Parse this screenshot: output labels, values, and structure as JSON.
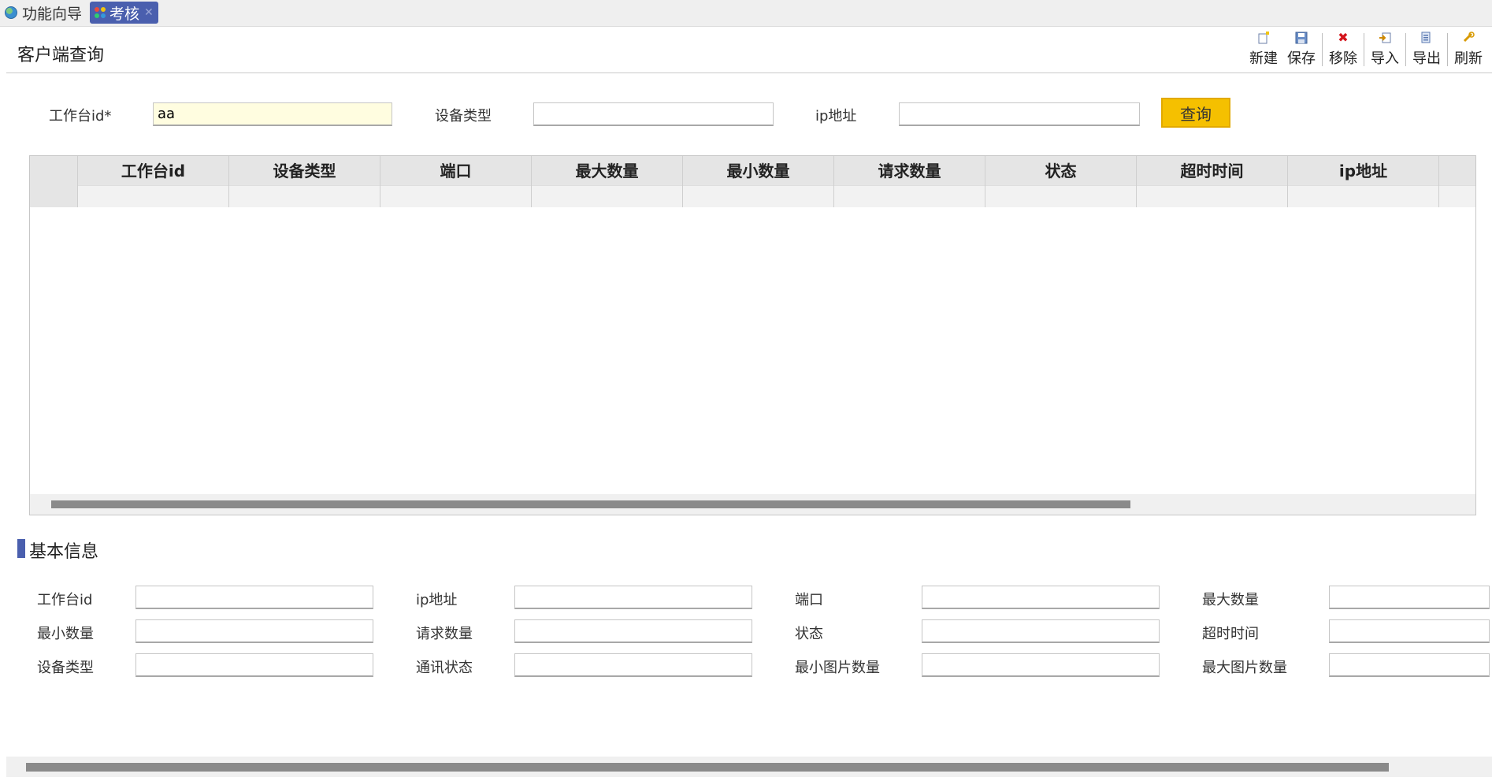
{
  "tabs": [
    {
      "label": "功能向导",
      "icon": "globe-icon",
      "active": false
    },
    {
      "label": "考核",
      "icon": "app-grid-icon",
      "active": true,
      "close_icon": "close-icon"
    }
  ],
  "page": {
    "title": "客户端查询"
  },
  "toolbar": [
    {
      "label": "新建",
      "icon": "new-doc-icon"
    },
    {
      "label": "保存",
      "icon": "save-icon"
    },
    {
      "label": "移除",
      "icon": "remove-x-icon"
    },
    {
      "label": "导入",
      "icon": "import-icon"
    },
    {
      "label": "导出",
      "icon": "export-icon"
    },
    {
      "label": "刷新",
      "icon": "refresh-icon"
    }
  ],
  "search": {
    "workstation_label": "工作台id*",
    "workstation_value": "aa",
    "device_type_label": "设备类型",
    "device_type_value": "",
    "ip_label": "ip地址",
    "ip_value": "",
    "query_button": "查询"
  },
  "grid": {
    "columns": [
      "工作台id",
      "设备类型",
      "端口",
      "最大数量",
      "最小数量",
      "请求数量",
      "状态",
      "超时时间",
      "ip地址"
    ],
    "rows": []
  },
  "detail": {
    "section_title": "基本信息",
    "fields": [
      {
        "label": "工作台id",
        "value": ""
      },
      {
        "label": "ip地址",
        "value": ""
      },
      {
        "label": "端口",
        "value": ""
      },
      {
        "label": "最大数量",
        "value": ""
      },
      {
        "label": "最小数量",
        "value": ""
      },
      {
        "label": "请求数量",
        "value": ""
      },
      {
        "label": "状态",
        "value": ""
      },
      {
        "label": "超时时间",
        "value": ""
      },
      {
        "label": "设备类型",
        "value": ""
      },
      {
        "label": "通讯状态",
        "value": ""
      },
      {
        "label": "最小图片数量",
        "value": ""
      },
      {
        "label": "最大图片数量",
        "value": ""
      }
    ]
  },
  "colors": {
    "accent": "#4a5fae",
    "query_button": "#f5c000",
    "focused_input": "#fffde0"
  }
}
